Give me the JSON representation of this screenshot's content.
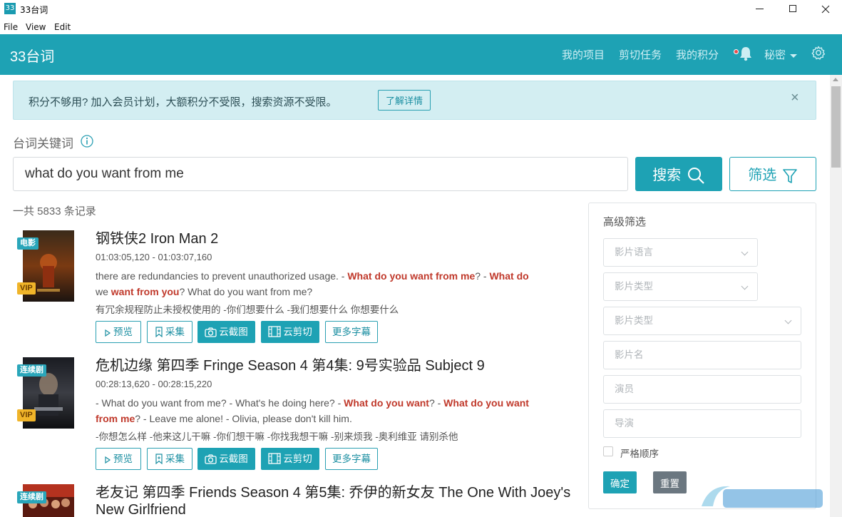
{
  "window": {
    "icon_text": "33",
    "title": "33台词"
  },
  "menubar": {
    "file": "File",
    "view": "View",
    "edit": "Edit"
  },
  "header": {
    "brand": "33台词",
    "nav": {
      "projects": "我的项目",
      "tasks": "剪切任务",
      "points": "我的积分"
    },
    "user": "秘密",
    "icons": [
      "bell-icon",
      "gear-icon"
    ],
    "accent_color": "#1ea2b4"
  },
  "alert": {
    "text": "积分不够用? 加入会员计划，大额积分不受限，搜索资源不受限。",
    "button": "了解详情",
    "close": "×"
  },
  "search": {
    "label": "台词关键词",
    "value": "what do you want from me",
    "button": "搜索",
    "filter_button": "筛选",
    "count": "一共 5833 条记录"
  },
  "results": [
    {
      "type_badge": "电影",
      "vip_badge": "VIP",
      "title": "钢铁侠2 Iron Man 2",
      "time": "01:03:05,120 - 01:03:07,160",
      "en_1": "there are redundancies to prevent unauthorized usage.  - ",
      "hl_1": "What do you want from me",
      "en_2": "? - ",
      "hl_2": "What do",
      "en_3": "we ",
      "hl_3": "want from you",
      "en_4": "? What do you want from me?",
      "zh": "有冗余规程防止未授权使用的  -你们想要什么 -我们想要什么 你想要什么",
      "buttons": {
        "preview": "预览",
        "collect": "采集",
        "screenshot": "云截图",
        "cut": "云剪切",
        "more": "更多字幕"
      }
    },
    {
      "type_badge": "连续剧",
      "vip_badge": "VIP",
      "title": "危机边缘 第四季 Fringe Season 4 第4集: 9号实验品 Subject 9",
      "time": "00:28:13,620 - 00:28:15,220",
      "en_1": "- What do you want from me? - What's he doing here?  - ",
      "hl_1": "What do you want",
      "en_2": "? - ",
      "hl_2": "What do you want",
      "hl_3": "from me",
      "en_3": "? - Leave me alone! - Olivia, please don't kill him.",
      "zh": "-你想怎么样 -他来这儿干嘛  -你们想干嘛 -你找我想干嘛 -别来烦我 -奥利维亚 请别杀他",
      "buttons": {
        "preview": "预览",
        "collect": "采集",
        "screenshot": "云截图",
        "cut": "云剪切",
        "more": "更多字幕"
      }
    },
    {
      "type_badge": "连续剧",
      "title": "老友记 第四季 Friends Season 4 第5集: 乔伊的新女友 The One With Joey's New Girlfriend"
    }
  ],
  "filter_panel": {
    "title": "高级筛选",
    "language": "影片语言",
    "type_1": "影片类型",
    "type_2": "影片类型",
    "name": "影片名",
    "actor": "演员",
    "director": "导演",
    "strict_order": "严格顺序",
    "confirm": "确定",
    "reset": "重置"
  }
}
